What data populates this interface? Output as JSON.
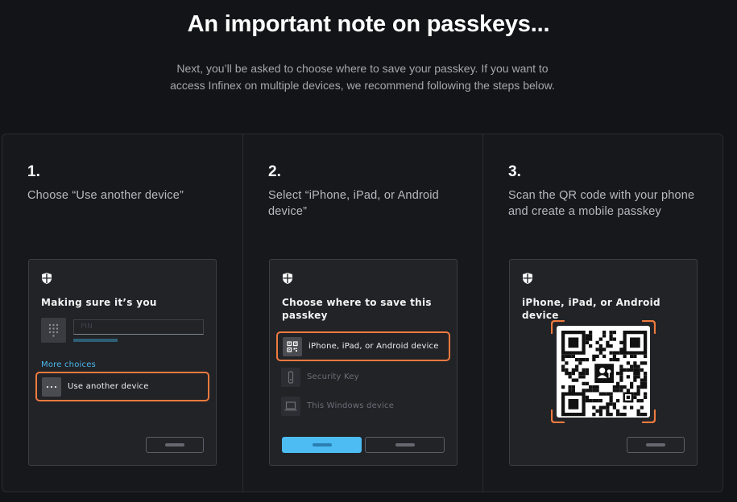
{
  "header": {
    "title": "An important note on passkeys...",
    "subtitle": "Next, you’ll be asked to choose where to save your passkey. If you want to access Infinex on multiple devices, we recommend following the steps below."
  },
  "steps": [
    {
      "number": "1.",
      "text": "Choose “Use another device”",
      "card": {
        "title": "Making sure it’s you",
        "pin_placeholder": "PIN",
        "more_choices": "More choices",
        "option_label": "Use another device"
      }
    },
    {
      "number": "2.",
      "text": "Select “iPhone, iPad, or Android device”",
      "card": {
        "title": "Choose where to save this passkey",
        "options": [
          {
            "label": "iPhone, iPad, or Android device",
            "icon": "qr-code-icon"
          },
          {
            "label": "Security Key",
            "icon": "usb-key-icon"
          },
          {
            "label": "This Windows device",
            "icon": "laptop-icon"
          }
        ]
      }
    },
    {
      "number": "3.",
      "text": "Scan the QR code with your phone and create a mobile passkey",
      "card": {
        "title": "iPhone, iPad, or Android device"
      }
    }
  ],
  "colors": {
    "background": "#131417",
    "accent_orange": "#ee7a3e",
    "accent_blue": "#4cbcf3",
    "link": "#4db8ec"
  }
}
